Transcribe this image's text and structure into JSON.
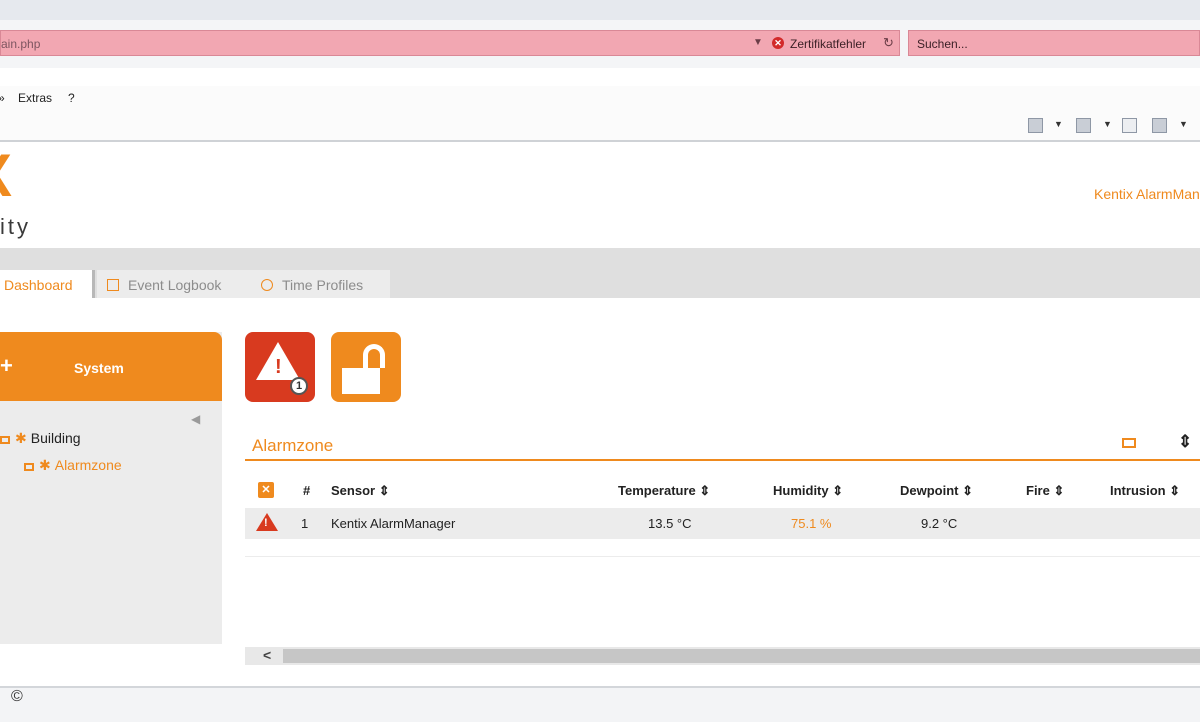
{
  "browser": {
    "address": "ain.php",
    "cert_error": "Zertifikatfehler",
    "search_placeholder": "Suchen..."
  },
  "menu": {
    "items": [
      "Extras",
      "?"
    ]
  },
  "toolbar": {
    "icons": [
      "home-icon",
      "rss-icon",
      "mail-icon",
      "print-icon"
    ]
  },
  "app": {
    "logo_text": "ity",
    "brand": "Kentix AlarmManager"
  },
  "tabs": [
    {
      "label": "Dashboard",
      "active": true
    },
    {
      "label": "Event Logbook",
      "active": false
    },
    {
      "label": "Time Profiles",
      "active": false
    }
  ],
  "sidebar": {
    "title": "System",
    "tree": [
      {
        "label": "Building",
        "level": 0
      },
      {
        "label": "Alarmzone",
        "level": 1,
        "selected": true
      }
    ]
  },
  "alarm": {
    "count": "1"
  },
  "zone": {
    "title": "Alarmzone"
  },
  "table": {
    "headers": {
      "num": "#",
      "sensor": "Sensor",
      "temperature": "Temperature",
      "humidity": "Humidity",
      "dewpoint": "Dewpoint",
      "fire": "Fire",
      "intrusion": "Intrusion"
    },
    "rows": [
      {
        "num": "1",
        "sensor": "Kentix AlarmManager",
        "temperature": "13.5 °C",
        "humidity": "75.1 %",
        "dewpoint": "9.2 °C",
        "fire": "",
        "intrusion": ""
      }
    ]
  },
  "footer": {
    "copyright": "©"
  },
  "colors": {
    "accent": "#ef8a1e",
    "alarm": "#d83a1f",
    "cert_bar": "#f2a7b2"
  }
}
